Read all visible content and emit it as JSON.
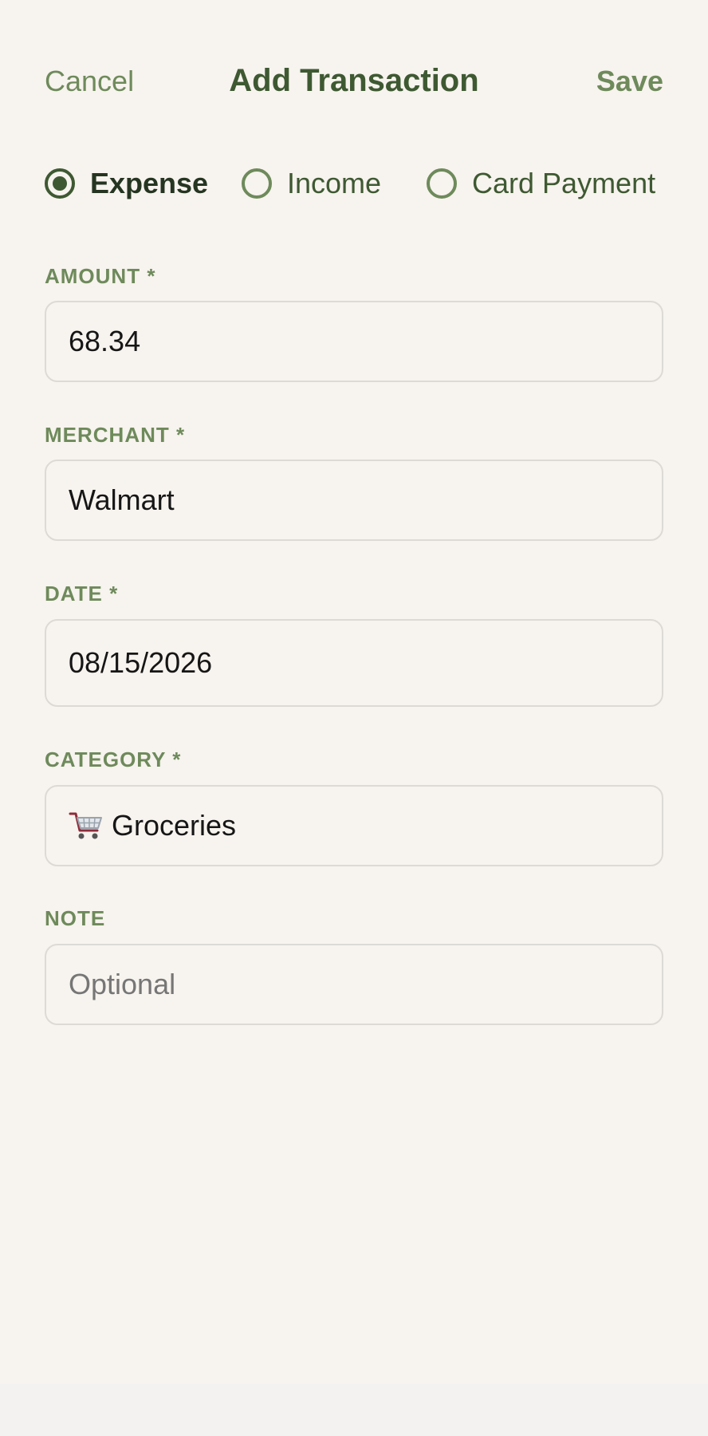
{
  "header": {
    "cancel_label": "Cancel",
    "title": "Add Transaction",
    "save_label": "Save"
  },
  "transaction_type": {
    "options": [
      {
        "label": "Expense",
        "selected": true
      },
      {
        "label": "Income",
        "selected": false
      },
      {
        "label": "Card Payment",
        "selected": false
      }
    ]
  },
  "form": {
    "amount": {
      "label": "AMOUNT *",
      "value": "68.34"
    },
    "merchant": {
      "label": "MERCHANT *",
      "value": "Walmart"
    },
    "date": {
      "label": "DATE *",
      "value": "08/15/2026"
    },
    "category": {
      "label": "CATEGORY *",
      "value": "Groceries",
      "icon": "shopping-cart-icon"
    },
    "note": {
      "label": "NOTE",
      "value": "",
      "placeholder": "Optional"
    }
  },
  "colors": {
    "background": "#f7f3ee",
    "accent_dark": "#3e5932",
    "accent": "#6e8a5b",
    "field_border": "#dddad6"
  }
}
